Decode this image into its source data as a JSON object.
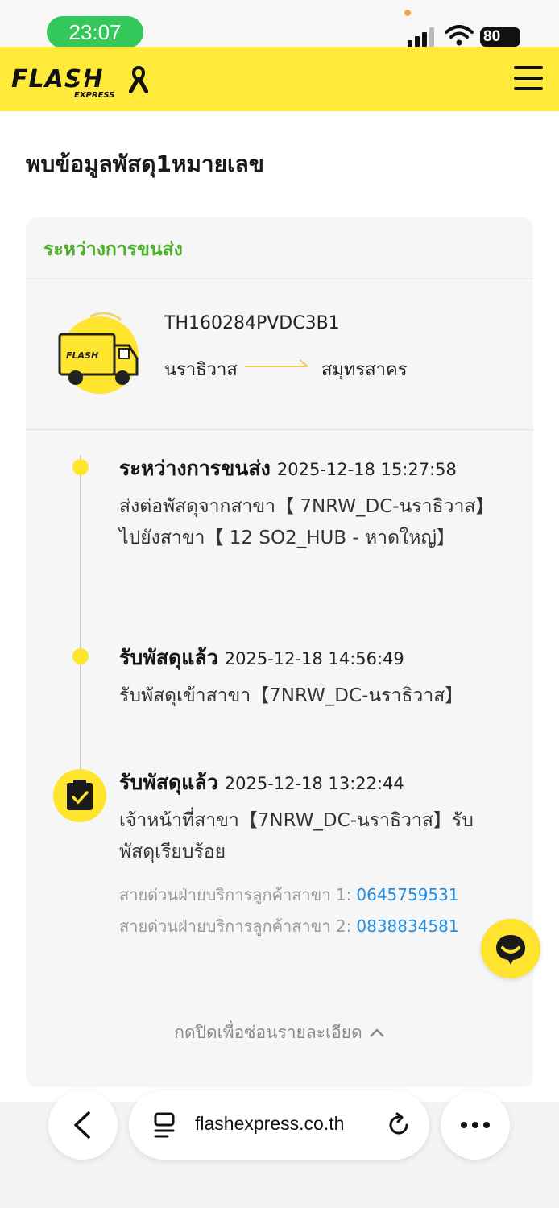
{
  "status_bar": {
    "time": "23:07",
    "battery": "80"
  },
  "header": {
    "brand": "FLASH",
    "brand_sub": "EXPRESS"
  },
  "page_title": "พบข้อมูลพัสดุ1หมายเลข",
  "parcel": {
    "status": "ระหว่างการขนส่ง",
    "tracking_number": "TH160284PVDC3B1",
    "origin": "นราธิวาส",
    "destination": "สมุทรสาคร"
  },
  "timeline": [
    {
      "title": "ระหว่างการขนส่ง",
      "time": "2025-12-18  15:27:58",
      "desc": "ส่งต่อพัสดุจากสาขา【 7NRW_DC-นราธิวาส】 ไปยังสาขา【 12 SO2_HUB - หาดใหญ่】"
    },
    {
      "title": "รับพัสดุแล้ว",
      "time": "2025-12-18  14:56:49",
      "desc": "รับพัสดุเข้าสาขา【7NRW_DC-นราธิวาส】"
    },
    {
      "title": "รับพัสดุแล้ว",
      "time": "2025-12-18  13:22:44",
      "desc": "เจ้าหน้าที่สาขา【7NRW_DC-นราธิวาส】รับพัสดุเรียบร้อย"
    }
  ],
  "hotlines": [
    {
      "label": "สายด่วนฝ่ายบริการลูกค้าสาขา 1:",
      "number": "0645759531"
    },
    {
      "label": "สายด่วนฝ่ายบริการลูกค้าสาขา 2:",
      "number": "0838834581"
    }
  ],
  "collapse_label": "กดปิดเพื่อซ่อนรายละเอียด",
  "browser": {
    "url": "flashexpress.co.th"
  },
  "colors": {
    "brand_yellow": "#ffe93b",
    "status_green": "#4caf2a",
    "link_blue": "#1f8ee6"
  }
}
